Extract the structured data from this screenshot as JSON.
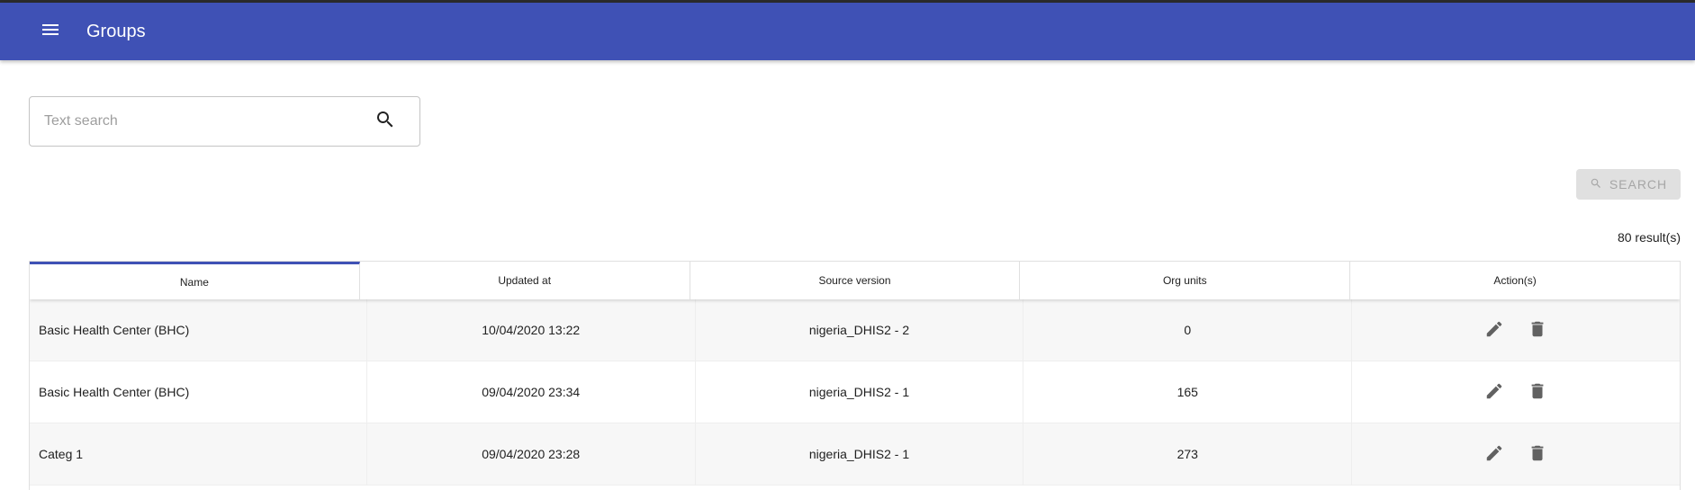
{
  "appbar": {
    "title": "Groups",
    "menu_icon": "menu-icon"
  },
  "search": {
    "placeholder": "Text search",
    "value": "",
    "icon": "search-icon",
    "button_label": "SEARCH"
  },
  "results": {
    "count_label": "80 result(s)"
  },
  "table": {
    "columns": [
      "Name",
      "Updated at",
      "Source version",
      "Org units",
      "Action(s)"
    ],
    "sorted_column": "Name",
    "rows": [
      {
        "name": "Basic Health Center (BHC)",
        "updated_at": "10/04/2020 13:22",
        "source_version": "nigeria_DHIS2 - 2",
        "org_units": "0"
      },
      {
        "name": "Basic Health Center (BHC)",
        "updated_at": "09/04/2020 23:34",
        "source_version": "nigeria_DHIS2 - 1",
        "org_units": "165"
      },
      {
        "name": "Categ 1",
        "updated_at": "09/04/2020 23:28",
        "source_version": "nigeria_DHIS2 - 1",
        "org_units": "273"
      }
    ],
    "row_actions": [
      "edit-icon",
      "delete-icon"
    ]
  },
  "colors": {
    "primary": "#3f51b5",
    "disabled_bg": "#e0e0e0",
    "disabled_text": "#a6a6a6",
    "icon": "#616161"
  }
}
